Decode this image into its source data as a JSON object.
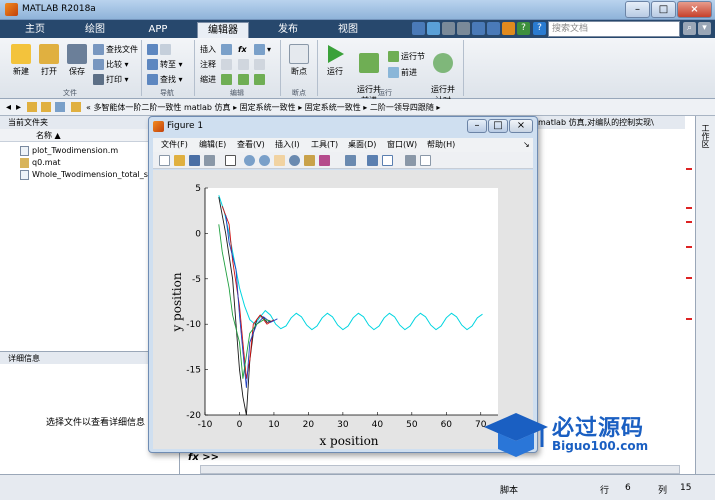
{
  "window": {
    "title": "MATLAB R2018a"
  },
  "ribbon_tabs": [
    "主页",
    "绘图",
    "APP",
    "编辑器",
    "发布",
    "视图"
  ],
  "search": {
    "placeholder": "搜索文档"
  },
  "ribbon": {
    "file": {
      "new": "新建",
      "open": "打开",
      "save": "保存",
      "find_files": "查找文件",
      "compare": "比较",
      "print": "打印",
      "group": "文件"
    },
    "navigate": {
      "goto": "转至",
      "find": "查找",
      "group": "导航"
    },
    "edit": {
      "insert": "插入",
      "comment": "注释",
      "indent": "缩进",
      "fx": "fx",
      "group": "编辑"
    },
    "breakpoints": {
      "breakpoint": "断点",
      "group": "断点"
    },
    "run": {
      "run": "运行",
      "run_advance": "运行并\n前进",
      "run_section": "运行节",
      "advance": "前进",
      "run_time": "运行并\n计时",
      "group": "运行"
    }
  },
  "address": {
    "path": "«  多智能体一阶二阶一致性 matlab 仿真 ▸ 固定系统一致性 ▸ 固定系统一致性 ▸ 二阶一领导四跟随 ▸"
  },
  "current_folder": {
    "header": "当前文件夹",
    "column_name": "名称 ▲",
    "files": [
      "plot_Twodimension.m",
      "q0.mat",
      "Whole_Twodimension_total_s"
    ]
  },
  "details": {
    "header": "详细信息",
    "message": "选择文件以查看详细信息"
  },
  "workspace_header": "matlab 仿真,对编队的控制实现\\",
  "sidebar_label": "工作区",
  "command": {
    "prompt": "fx >>"
  },
  "status": {
    "mode": "脚本",
    "row_label": "行",
    "row": "6",
    "col_label": "列",
    "col": "15"
  },
  "figure": {
    "title": "Figure 1",
    "menus": [
      "文件(F)",
      "编辑(E)",
      "查看(V)",
      "插入(I)",
      "工具(T)",
      "桌面(D)",
      "窗口(W)",
      "帮助(H)"
    ]
  },
  "chart_data": {
    "type": "line",
    "xlabel": "x position",
    "ylabel": "y position",
    "xlim": [
      -10,
      75
    ],
    "ylim": [
      -20,
      5
    ],
    "xticks": [
      -10,
      0,
      10,
      20,
      30,
      40,
      50,
      60,
      70
    ],
    "yticks": [
      5,
      0,
      -5,
      -10,
      -15,
      -20
    ],
    "grid": false,
    "leader_series": {
      "color": "#00d5e0",
      "x": [
        -6,
        -4.5,
        -3,
        -1.5,
        0,
        1.5,
        3,
        4.5,
        6,
        7.5,
        9,
        10.5,
        12,
        13.5,
        15,
        16.5,
        18,
        19.5,
        21,
        22.5,
        24,
        25.5,
        27,
        28.5,
        30,
        31.5,
        33,
        34.5,
        36,
        37.5,
        39,
        40.5,
        42,
        43.5,
        45,
        46.5,
        48,
        49.5,
        51,
        52.5,
        54,
        55.5,
        57,
        58.5,
        60,
        61.5,
        63,
        64.5,
        66,
        67.5,
        69,
        70.5
      ],
      "y": [
        4.2,
        2.5,
        0,
        -3,
        -6,
        -8,
        -9.5,
        -10,
        -9.2,
        -8.5,
        -9,
        -10,
        -10.5,
        -10.2,
        -9.3,
        -8.8,
        -9.2,
        -10.1,
        -10.6,
        -10.2,
        -9.3,
        -8.8,
        -9.2,
        -10.1,
        -10.6,
        -10.2,
        -9.3,
        -8.8,
        -9.2,
        -10.1,
        -10.6,
        -10.2,
        -9.3,
        -8.8,
        -9.2,
        -10.1,
        -10.6,
        -10.2,
        -9.3,
        -8.8,
        -9.2,
        -10.1,
        -10.6,
        -10.2,
        -9.3,
        -8.8,
        -9.2,
        -10.1,
        -10.6,
        -10.2,
        -9.3,
        -8.9
      ]
    },
    "follower_series": [
      {
        "color": "#1a1a1a",
        "x": [
          -6,
          -4,
          -2,
          -1,
          0,
          1,
          2,
          3,
          4,
          5,
          6,
          7,
          8,
          10
        ],
        "y": [
          4,
          0,
          -5,
          -10,
          -15,
          -18,
          -20,
          -14,
          -11,
          -9.5,
          -9,
          -9.3,
          -9.8,
          -9.6
        ]
      },
      {
        "color": "#d01010",
        "x": [
          -5,
          -3,
          -2,
          0,
          1,
          2,
          3,
          4,
          6,
          8,
          10
        ],
        "y": [
          3,
          1,
          -3,
          -8,
          -12,
          -16,
          -14,
          -10,
          -9,
          -10,
          -9.5
        ]
      },
      {
        "color": "#2040c0",
        "x": [
          -4,
          -3,
          -1,
          0,
          1,
          2,
          3,
          5,
          7,
          9,
          11
        ],
        "y": [
          2,
          -1,
          -4,
          -9,
          -13,
          -17,
          -12,
          -10,
          -9.2,
          -9.8,
          -9.4
        ]
      },
      {
        "color": "#20a040",
        "x": [
          -6,
          -5,
          -3,
          -2,
          0,
          1,
          3,
          5,
          7,
          9
        ],
        "y": [
          1,
          -2,
          -6,
          -9,
          -12,
          -16,
          -11,
          -10,
          -9.5,
          -9.6
        ]
      }
    ]
  },
  "colors": {
    "ribbon_tab_bg": "#27486d",
    "watermark": "#1a5fc2"
  },
  "watermark": {
    "text": "必过源码",
    "url": "Biguo100.com"
  }
}
